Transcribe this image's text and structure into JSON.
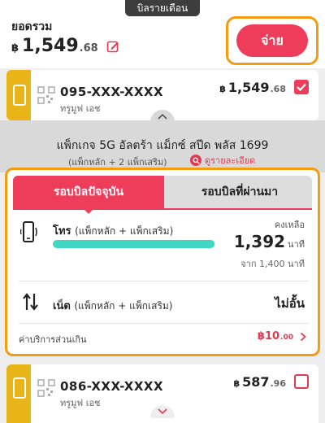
{
  "header": {
    "tab_label": "บิลรายเดือน"
  },
  "summary": {
    "total_label": "ยอดรวม",
    "currency": "฿",
    "amount_main": "1,549",
    "amount_dec": ".68",
    "pay_label": "จ่าย"
  },
  "lines": [
    {
      "number": "095-XXX-XXXX",
      "operator": "ทรูมูฟ เอช",
      "currency": "฿",
      "amount_main": "1,549",
      "amount_dec": ".68",
      "checked": true
    },
    {
      "number": "086-XXX-XXXX",
      "operator": "ทรูมูฟ เอช",
      "currency": "฿",
      "amount_main": "587",
      "amount_dec": ".96",
      "checked": false
    }
  ],
  "package": {
    "name": "แพ็กเกจ 5G อัลตร้า แม็กซ์ สปีด พลัส 1699",
    "sub": "(แพ็กหลัก + 2 แพ็กเสริม)",
    "detail_link": "ดูรายละเอียด"
  },
  "usage": {
    "tabs": [
      "รอบบิลปัจจุบัน",
      "รอบบิลที่ผ่านมา"
    ],
    "voice": {
      "label": "โทร",
      "label_sub": "(แพ็กหลัก + แพ็กเสริม)",
      "remain_label": "คงเหลือ",
      "remain_value": "1,392",
      "remain_unit": "นาที",
      "of_text": "จาก 1,400 นาที",
      "progress_fraction": 0.994
    },
    "data": {
      "label": "เน็ต",
      "label_sub": "(แพ็กหลัก + แพ็กเสริม)",
      "value": "ไม่อั้น"
    },
    "extra": {
      "label": "ค่าบริการส่วนเกิน",
      "amount_main": "฿10",
      "amount_dec": ".00"
    }
  },
  "colors": {
    "accent_red": "#ee3d5b",
    "highlight_orange": "#f39c12",
    "line_yellow": "#e8b417",
    "progress_teal": "#3fd6c3"
  }
}
